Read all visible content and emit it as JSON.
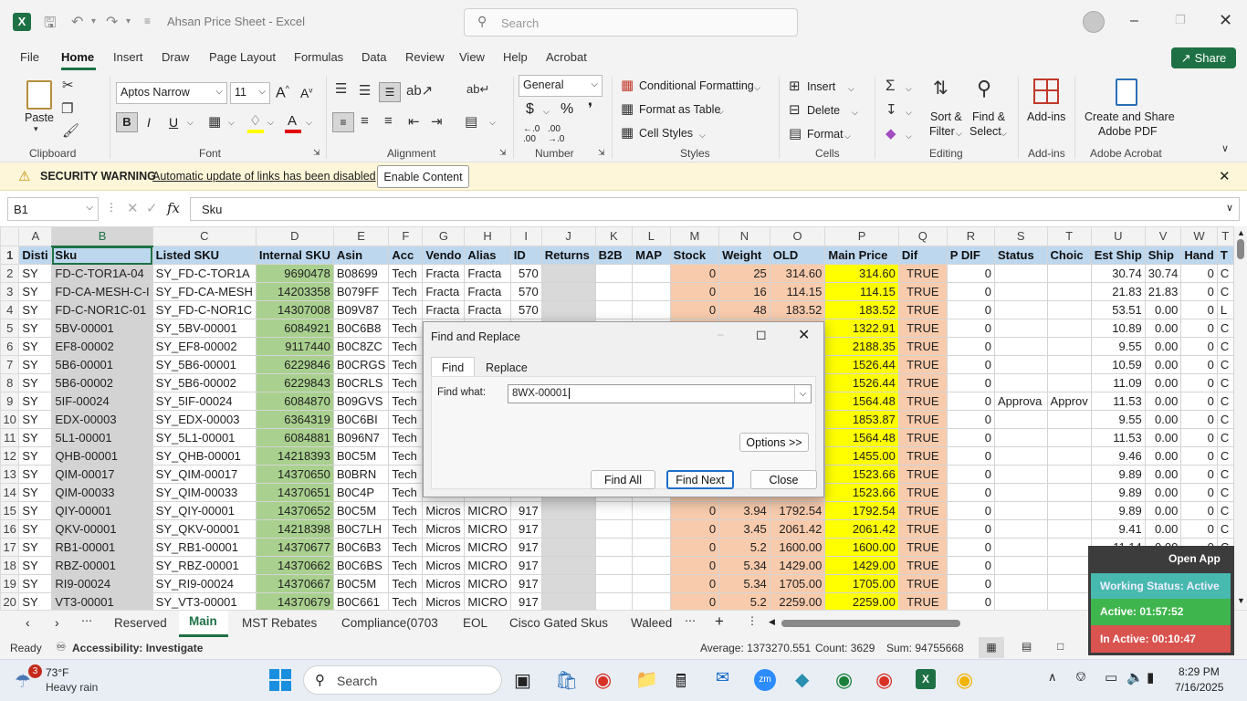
{
  "window": {
    "title": "Ahsan Price Sheet  -  Excel",
    "search_placeholder": "Search"
  },
  "menu": [
    "File",
    "Home",
    "Insert",
    "Draw",
    "Page Layout",
    "Formulas",
    "Data",
    "Review",
    "View",
    "Help",
    "Acrobat"
  ],
  "share_label": "Share",
  "ribbon": {
    "paste": "Paste",
    "font_name": "Aptos Narrow",
    "font_size": "11",
    "number_format": "General",
    "conditional_formatting": "Conditional Formatting",
    "format_as_table": "Format as Table",
    "cell_styles": "Cell Styles",
    "insert": "Insert",
    "delete": "Delete",
    "format": "Format",
    "sort_filter_1": "Sort &",
    "sort_filter_2": "Filter",
    "find_select_1": "Find &",
    "find_select_2": "Select",
    "addins": "Add-ins",
    "create_share_1": "Create and Share",
    "create_share_2": "Adobe PDF",
    "groups": {
      "clipboard": "Clipboard",
      "font": "Font",
      "alignment": "Alignment",
      "number": "Number",
      "styles": "Styles",
      "cells": "Cells",
      "editing": "Editing",
      "addins": "Add-ins",
      "acrobat": "Adobe Acrobat"
    }
  },
  "security": {
    "label": "SECURITY WARNING",
    "message": "Automatic update of links has been disabled",
    "button": "Enable Content"
  },
  "formula_bar": {
    "name_box": "B1",
    "fx": "fx",
    "content": "Sku"
  },
  "columns": [
    "A",
    "B",
    "C",
    "D",
    "E",
    "F",
    "G",
    "H",
    "I",
    "J",
    "K",
    "L",
    "M",
    "N",
    "O",
    "P",
    "Q",
    "R",
    "S",
    "T",
    "U",
    "V",
    "W",
    "T"
  ],
  "header_row": [
    "Disti",
    "Sku",
    "Listed SKU",
    "Internal SKU",
    "Asin",
    "Acc",
    "Vendo",
    "Alias",
    "ID",
    "Returns",
    "B2B",
    "MAP",
    "Stock",
    "Weight",
    "OLD",
    "Main Price",
    "Dif",
    "P DIF",
    "Status",
    "Choic",
    "Est Ship",
    "Ship",
    "Hand",
    "T"
  ],
  "rows": [
    [
      "SY",
      "FD-C-TOR1A-04",
      "SY_FD-C-TOR1A",
      "9690478",
      "B08699",
      "Tech",
      "Fracta",
      "Fracta",
      "570",
      "",
      "",
      "",
      "0",
      "25",
      "314.60",
      "314.60",
      "TRUE",
      "0",
      "",
      "",
      "30.74",
      "30.74",
      "0",
      "C"
    ],
    [
      "SY",
      "FD-CA-MESH-C-I",
      "SY_FD-CA-MESH",
      "14203358",
      "B079FF",
      "Tech",
      "Fracta",
      "Fracta",
      "570",
      "",
      "",
      "",
      "0",
      "16",
      "114.15",
      "114.15",
      "TRUE",
      "0",
      "",
      "",
      "21.83",
      "21.83",
      "0",
      "C"
    ],
    [
      "SY",
      "FD-C-NOR1C-01",
      "SY_FD-C-NOR1C",
      "14307008",
      "B09V87",
      "Tech",
      "Fracta",
      "Fracta",
      "570",
      "",
      "",
      "",
      "0",
      "48",
      "183.52",
      "183.52",
      "TRUE",
      "0",
      "",
      "",
      "53.51",
      "0.00",
      "0",
      "L"
    ],
    [
      "SY",
      "5BV-00001",
      "SY_5BV-00001",
      "6084921",
      "B0C6B8",
      "Tech",
      "Micros",
      "",
      "",
      "",
      "",
      "",
      "",
      "",
      "",
      "1322.91",
      "TRUE",
      "0",
      "",
      "",
      "10.89",
      "0.00",
      "0",
      "C"
    ],
    [
      "SY",
      "EF8-00002",
      "SY_EF8-00002",
      "9117440",
      "B0C8ZC",
      "Tech",
      "Micros",
      "",
      "",
      "",
      "",
      "",
      "",
      "",
      "",
      "2188.35",
      "TRUE",
      "0",
      "",
      "",
      "9.55",
      "0.00",
      "0",
      "C"
    ],
    [
      "SY",
      "5B6-00001",
      "SY_5B6-00001",
      "6229846",
      "B0CRGS",
      "Tech",
      "Micros",
      "",
      "",
      "",
      "",
      "",
      "",
      "",
      "",
      "1526.44",
      "TRUE",
      "0",
      "",
      "",
      "10.59",
      "0.00",
      "0",
      "C"
    ],
    [
      "SY",
      "5B6-00002",
      "SY_5B6-00002",
      "6229843",
      "B0CRLS",
      "Tech",
      "Micros",
      "",
      "",
      "",
      "",
      "",
      "",
      "",
      "",
      "1526.44",
      "TRUE",
      "0",
      "",
      "",
      "11.09",
      "0.00",
      "0",
      "C"
    ],
    [
      "SY",
      "5IF-00024",
      "SY_5IF-00024",
      "6084870",
      "B09GVS",
      "Tech",
      "Micros",
      "",
      "",
      "",
      "",
      "",
      "",
      "",
      "",
      "1564.48",
      "TRUE",
      "0",
      "Approva",
      "Approv",
      "11.53",
      "0.00",
      "0",
      "C"
    ],
    [
      "SY",
      "EDX-00003",
      "SY_EDX-00003",
      "6364319",
      "B0C6BI",
      "Tech",
      "Micros",
      "",
      "",
      "",
      "",
      "",
      "",
      "",
      "",
      "1853.87",
      "TRUE",
      "0",
      "",
      "",
      "9.55",
      "0.00",
      "0",
      "C"
    ],
    [
      "SY",
      "5L1-00001",
      "SY_5L1-00001",
      "6084881",
      "B096N7",
      "Tech",
      "Micros",
      "",
      "",
      "",
      "",
      "",
      "",
      "",
      "",
      "1564.48",
      "TRUE",
      "0",
      "",
      "",
      "11.53",
      "0.00",
      "0",
      "C"
    ],
    [
      "SY",
      "QHB-00001",
      "SY_QHB-00001",
      "14218393",
      "B0C5M",
      "Tech",
      "Micros",
      "",
      "",
      "",
      "",
      "",
      "",
      "",
      "",
      "1455.00",
      "TRUE",
      "0",
      "",
      "",
      "9.46",
      "0.00",
      "0",
      "C"
    ],
    [
      "SY",
      "QIM-00017",
      "SY_QIM-00017",
      "14370650",
      "B0BRN",
      "Tech",
      "Micros",
      "",
      "",
      "",
      "",
      "",
      "",
      "",
      "",
      "1523.66",
      "TRUE",
      "0",
      "",
      "",
      "9.89",
      "0.00",
      "0",
      "C"
    ],
    [
      "SY",
      "QIM-00033",
      "SY_QIM-00033",
      "14370651",
      "B0C4P",
      "Tech",
      "Micros",
      "",
      "",
      "",
      "",
      "",
      "",
      "",
      "",
      "1523.66",
      "TRUE",
      "0",
      "",
      "",
      "9.89",
      "0.00",
      "0",
      "C"
    ],
    [
      "SY",
      "QIY-00001",
      "SY_QIY-00001",
      "14370652",
      "B0C5M",
      "Tech",
      "Micros",
      "MICRO",
      "917",
      "",
      "",
      "",
      "0",
      "3.94",
      "1792.54",
      "1792.54",
      "TRUE",
      "0",
      "",
      "",
      "9.89",
      "0.00",
      "0",
      "C"
    ],
    [
      "SY",
      "QKV-00001",
      "SY_QKV-00001",
      "14218398",
      "B0C7LH",
      "Tech",
      "Micros",
      "MICRO",
      "917",
      "",
      "",
      "",
      "0",
      "3.45",
      "2061.42",
      "2061.42",
      "TRUE",
      "0",
      "",
      "",
      "9.41",
      "0.00",
      "0",
      "C"
    ],
    [
      "SY",
      "RB1-00001",
      "SY_RB1-00001",
      "14370677",
      "B0C6B3",
      "Tech",
      "Micros",
      "MICRO",
      "917",
      "",
      "",
      "",
      "0",
      "5.2",
      "1600.00",
      "1600.00",
      "TRUE",
      "0",
      "",
      "",
      "11.14",
      "0.00",
      "0",
      "C"
    ],
    [
      "SY",
      "RBZ-00001",
      "SY_RBZ-00001",
      "14370662",
      "B0C6BS",
      "Tech",
      "Micros",
      "MICRO",
      "917",
      "",
      "",
      "",
      "0",
      "5.34",
      "1429.00",
      "1429.00",
      "TRUE",
      "0",
      "",
      "",
      "11.28",
      "0.00",
      "0",
      "C"
    ],
    [
      "SY",
      "RI9-00024",
      "SY_RI9-00024",
      "14370667",
      "B0C5M",
      "Tech",
      "Micros",
      "MICRO",
      "917",
      "",
      "",
      "",
      "0",
      "5.34",
      "1705.00",
      "1705.00",
      "TRUE",
      "0",
      "",
      "",
      "11.28",
      "0.00",
      "0",
      "C"
    ],
    [
      "SY",
      "VT3-00001",
      "SY_VT3-00001",
      "14370679",
      "B0C661",
      "Tech",
      "Micros",
      "MICRO",
      "917",
      "",
      "",
      "",
      "0",
      "5.2",
      "2259.00",
      "2259.00",
      "TRUE",
      "0",
      "",
      "",
      "11.14",
      "0.00",
      "0",
      "C"
    ]
  ],
  "dialog": {
    "title": "Find and Replace",
    "tab_find": "Find",
    "tab_replace": "Replace",
    "find_label": "Find what:",
    "find_value": "8WX-00001",
    "options": "Options >>",
    "find_all": "Find All",
    "find_next": "Find Next",
    "close": "Close"
  },
  "sheet_tabs": [
    "Reserved",
    "Main",
    "MST Rebates",
    "Compliance(0703",
    "EOL",
    "Cisco Gated Skus",
    "Waleed"
  ],
  "active_tab": "Main",
  "status": {
    "ready": "Ready",
    "accessibility": "Accessibility: Investigate",
    "average": "Average: 1373270.551",
    "count": "Count: 3629",
    "sum": "Sum: 94755668",
    "zoom": "100%"
  },
  "overlay": {
    "open_app": "Open App",
    "working": "Working Status: Active",
    "active": "Active: 01:57:52",
    "inactive": "In Active: 00:10:47"
  },
  "taskbar": {
    "weather_temp": "73°F",
    "weather_desc": "Heavy rain",
    "weather_badge": "3",
    "search": "Search",
    "time": "8:29 PM",
    "date": "7/16/2025"
  },
  "colors": {
    "excel_green": "#1e7145",
    "header_blue": "#bdd7ee",
    "green": "#a9d08e",
    "pink": "#f8cbad",
    "yellow": "#ffff00"
  }
}
